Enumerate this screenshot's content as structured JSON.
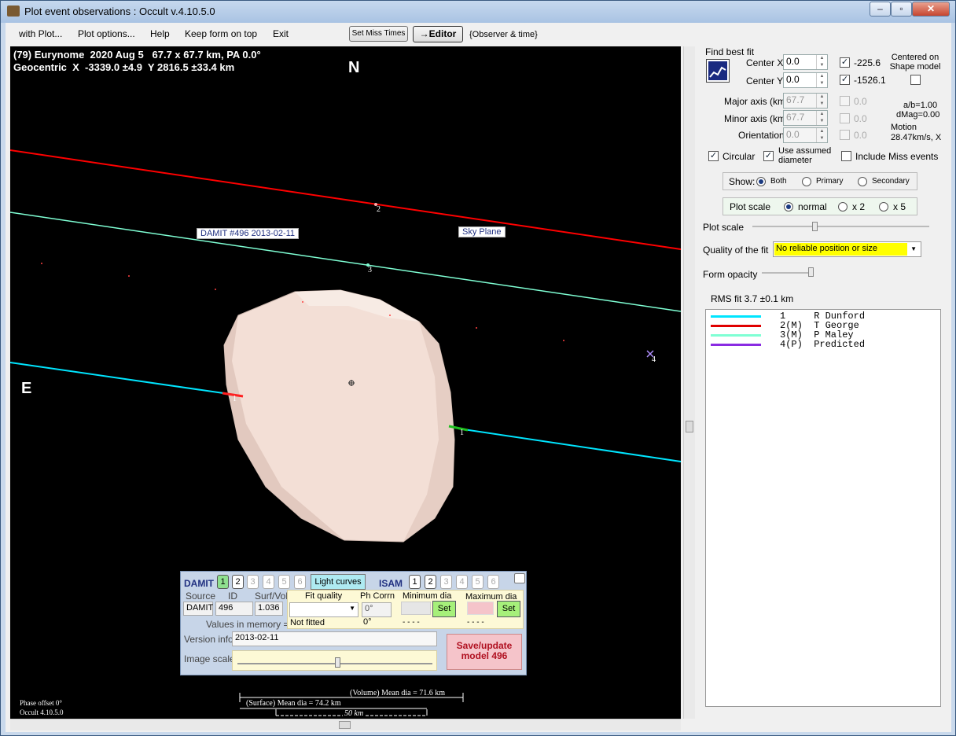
{
  "window": {
    "title": "Plot event observations : Occult v.4.10.5.0"
  },
  "menu": {
    "items": [
      "with Plot...",
      "Plot options...",
      "Help",
      "Keep form on top",
      "Exit"
    ],
    "set_miss": "Set Miss Times",
    "editor": "→Editor",
    "observer_time": "{Observer & time}"
  },
  "plot": {
    "header1": "(79) Eurynome  2020 Aug 5   67.7 x 67.7 km, PA 0.0°",
    "header2": "Geocentric  X  -3339.0 ±4.9  Y 2816.5 ±33.4 km",
    "north": "N",
    "east": "E",
    "damit_label": "DAMIT #496 2013-02-11",
    "sky_label": "Sky Plane",
    "chord_labels": [
      "1",
      "1",
      "2",
      "3",
      "4"
    ],
    "phase_offset": "Phase offset 0°",
    "version": "Occult 4.10.5.0",
    "volume_dia": "(Volume) Mean dia = 71.6 km",
    "surface_dia": "(Surface) Mean dia = 74.2 km",
    "scale": "50 km"
  },
  "damit": {
    "title": "DAMIT",
    "isam": "ISAM",
    "light_curves": "Light curves",
    "numbers": [
      "1",
      "2",
      "3",
      "4",
      "5",
      "6"
    ],
    "source_h": "Source",
    "id_h": "ID",
    "surfvol_h": "Surf/Vol",
    "source": "DAMIT",
    "id": "496",
    "surfvol": "1.036",
    "values_mem": "Values in memory =>",
    "fit_quality_h": "Fit quality",
    "ph_corr_h": "Ph Corrn",
    "min_dia_h": "Minimum dia",
    "max_dia_h": "Maximum dia",
    "ph_corr": "0°",
    "not_fitted": "Not fitted",
    "ph_corr2": "0°",
    "dashes": "- - - -",
    "dashes2": "- - - -",
    "set": "Set",
    "version_info_h": "Version info",
    "version_info": "2013-02-11",
    "image_scale_h": "Image scale",
    "save_btn": "Save/update model 496"
  },
  "right": {
    "find_best_fit": "Find best fit",
    "center_x_h": "Center X",
    "center_x": "0.0",
    "cx_val": "-225.6",
    "center_y_h": "Center Y",
    "center_y": "0.0",
    "cy_val": "-1526.1",
    "centered_on": "Centered on Shape model",
    "major_h": "Major axis (km)",
    "major": "67.7",
    "major_v": "0.0",
    "minor_h": "Minor axis (km)",
    "minor": "67.7",
    "minor_v": "0.0",
    "orient_h": "Orientation",
    "orient": "0.0",
    "orient_v": "0.0",
    "ab": "a/b=1.00",
    "dmag": "dMag=0.00",
    "motion_h": "Motion",
    "motion": "28.47km/s, X",
    "circular": "Circular",
    "use_assumed": "Use assumed diameter",
    "include_miss": "Include Miss events",
    "show_h": "Show:",
    "both": "Both",
    "primary": "Primary",
    "secondary": "Secondary",
    "plot_scale_grp": "Plot scale",
    "normal": "normal",
    "x2": "x 2",
    "x5": "x 5",
    "plot_scale_h": "Plot scale",
    "quality_h": "Quality of the fit",
    "quality": "No reliable position or size",
    "form_opacity": "Form opacity",
    "rms": "RMS fit 3.7 ±0.1 km"
  },
  "legend": [
    {
      "text": "1     R Dunford",
      "color": "#00e5ff"
    },
    {
      "text": "2(M)  T George",
      "color": "#e00000"
    },
    {
      "text": "3(M)  P Maley",
      "color": "#7fffd4"
    },
    {
      "text": "4(P)  Predicted",
      "color": "#8a2be2"
    }
  ],
  "colors": {
    "chord1": "#00e5ff",
    "chord2": "#ff0000",
    "chord3": "#7fffd4",
    "shape": "#f3dfd6"
  }
}
